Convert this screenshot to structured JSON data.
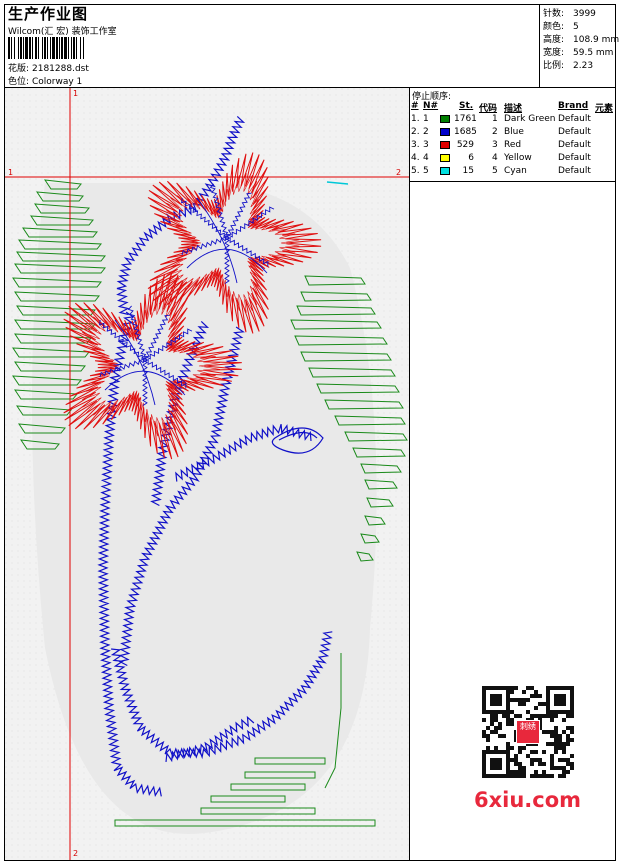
{
  "header": {
    "title": "生产作业图",
    "company": "Wilcom(汇 宏) 装饰工作室",
    "design_label": "花版:",
    "design_value": "2181288.dst",
    "colorway_label": "色位:",
    "colorway_value": "Colorway 1"
  },
  "stats": {
    "stitches_label": "针数:",
    "stitches_value": "3999",
    "colors_label": "颜色:",
    "colors_value": "5",
    "height_label": "高度:",
    "height_value": "108.9 mm",
    "width_label": "宽度:",
    "width_value": "59.5 mm",
    "scale_label": "比例:",
    "scale_value": "2.23"
  },
  "guides": {
    "v_top": "1",
    "v_bottom": "2",
    "h_left": "1",
    "h_right": "2"
  },
  "color_table": {
    "title": "停止顺序:",
    "headers": {
      "num": "#",
      "no": "N#",
      "st": "St.",
      "code": "代码",
      "desc": "描述",
      "brand": "Brand",
      "element": "元素"
    },
    "rows": [
      {
        "num": "1.",
        "no": "1",
        "color": "#007f00",
        "st": "1761",
        "code": "1",
        "desc": "Dark Green",
        "brand": "Default"
      },
      {
        "num": "2.",
        "no": "2",
        "color": "#0000cc",
        "st": "1685",
        "code": "2",
        "desc": "Blue",
        "brand": "Default"
      },
      {
        "num": "3.",
        "no": "3",
        "color": "#e00000",
        "st": "529",
        "code": "3",
        "desc": "Red",
        "brand": "Default"
      },
      {
        "num": "4.",
        "no": "4",
        "color": "#ffff00",
        "st": "6",
        "code": "4",
        "desc": "Yellow",
        "brand": "Default"
      },
      {
        "num": "5.",
        "no": "5",
        "color": "#00e0e0",
        "st": "15",
        "code": "5",
        "desc": "Cyan",
        "brand": "Default"
      }
    ]
  },
  "watermark": {
    "site": "6xiu.com",
    "qr_badge": "刺绣"
  }
}
